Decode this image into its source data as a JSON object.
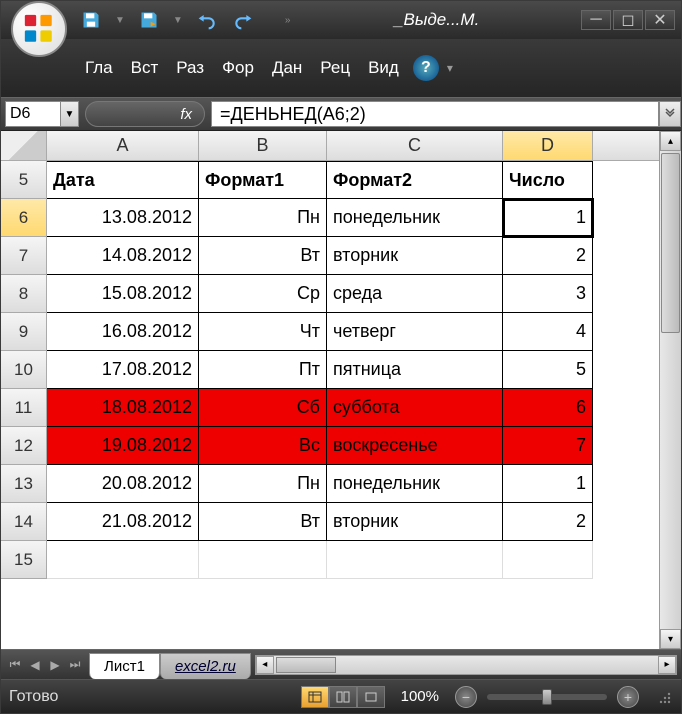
{
  "title": "_Выде...М.",
  "ribbon": {
    "tabs": [
      "Гла",
      "Вст",
      "Раз",
      "Фор",
      "Дан",
      "Рец",
      "Вид"
    ]
  },
  "nameBox": "D6",
  "fxLabel": "fx",
  "formula": "=ДЕНЬНЕД(A6;2)",
  "columns": [
    "A",
    "B",
    "C",
    "D"
  ],
  "selectedCol": "D",
  "selectedRow": 6,
  "headers": {
    "A": "Дата",
    "B": "Формат1",
    "C": "Формат2",
    "D": "Число"
  },
  "rows": [
    {
      "n": 5,
      "header": true
    },
    {
      "n": 6,
      "A": "13.08.2012",
      "B": "Пн",
      "C": "понедельник",
      "D": "1",
      "sel": true
    },
    {
      "n": 7,
      "A": "14.08.2012",
      "B": "Вт",
      "C": "вторник",
      "D": "2"
    },
    {
      "n": 8,
      "A": "15.08.2012",
      "B": "Ср",
      "C": "среда",
      "D": "3"
    },
    {
      "n": 9,
      "A": "16.08.2012",
      "B": "Чт",
      "C": "четверг",
      "D": "4"
    },
    {
      "n": 10,
      "A": "17.08.2012",
      "B": "Пт",
      "C": "пятница",
      "D": "5"
    },
    {
      "n": 11,
      "A": "18.08.2012",
      "B": "Сб",
      "C": "суббота",
      "D": "6",
      "red": true
    },
    {
      "n": 12,
      "A": "19.08.2012",
      "B": "Вс",
      "C": "воскресенье",
      "D": "7",
      "red": true
    },
    {
      "n": 13,
      "A": "20.08.2012",
      "B": "Пн",
      "C": "понедельник",
      "D": "1"
    },
    {
      "n": 14,
      "A": "21.08.2012",
      "B": "Вт",
      "C": "вторник",
      "D": "2"
    },
    {
      "n": 15,
      "empty": true
    }
  ],
  "sheets": {
    "active": "Лист1",
    "other": "excel2.ru"
  },
  "status": "Готово",
  "zoom": "100%"
}
